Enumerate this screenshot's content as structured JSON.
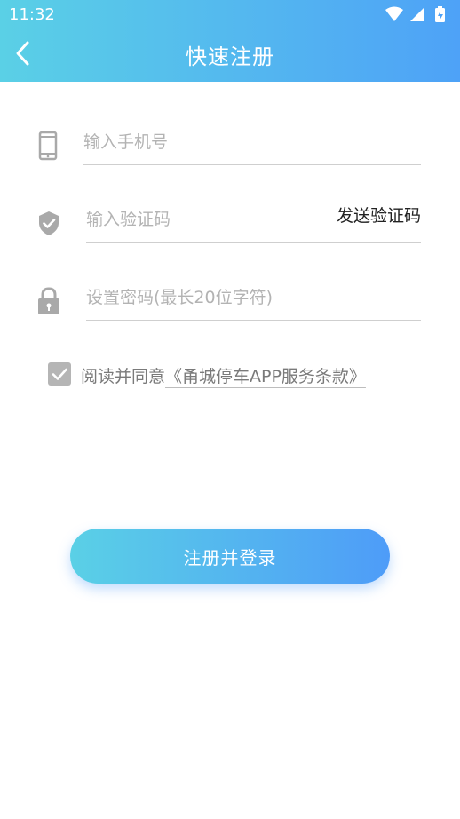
{
  "status_bar": {
    "time": "11:32"
  },
  "header": {
    "title": "快速注册"
  },
  "form": {
    "phone": {
      "placeholder": "输入手机号",
      "value": ""
    },
    "code": {
      "placeholder": "输入验证码",
      "value": "",
      "send_label": "发送验证码"
    },
    "password": {
      "placeholder": "设置密码(最长20位字符)",
      "value": ""
    }
  },
  "agreement": {
    "checked": true,
    "prefix": "阅读并同意",
    "terms_link": "《甬城停车APP服务条款》"
  },
  "submit_label": "注册并登录",
  "colors": {
    "gradient_start": "#5ad0e6",
    "gradient_end": "#4ea2f7",
    "icon_gray": "#a9a9a9"
  }
}
